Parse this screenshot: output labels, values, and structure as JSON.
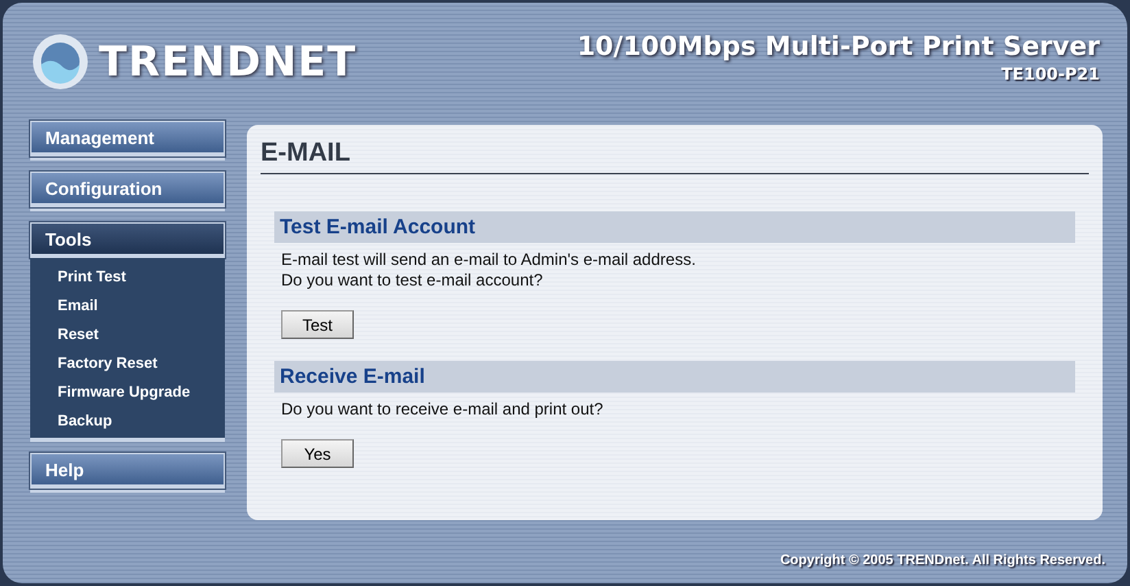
{
  "header": {
    "logo": "TRENDNET",
    "title": "10/100Mbps Multi-Port Print Server",
    "model": "TE100-P21"
  },
  "sidebar": {
    "items": [
      {
        "label": "Management",
        "selected": false
      },
      {
        "label": "Configuration",
        "selected": false
      },
      {
        "label": "Tools",
        "selected": true,
        "children": [
          {
            "label": "Print Test"
          },
          {
            "label": "Email"
          },
          {
            "label": "Reset"
          },
          {
            "label": "Factory Reset"
          },
          {
            "label": "Firmware Upgrade"
          },
          {
            "label": "Backup"
          }
        ]
      },
      {
        "label": "Help",
        "selected": false
      }
    ]
  },
  "content": {
    "title": "E-MAIL",
    "sections": [
      {
        "heading": "Test E-mail Account",
        "lines": [
          "E-mail test will send an e-mail to Admin's e-mail address.",
          "Do you want to test e-mail account?"
        ],
        "button": "Test"
      },
      {
        "heading": "Receive E-mail",
        "lines": [
          "Do you want to receive e-mail and print out?"
        ],
        "button": "Yes"
      }
    ]
  },
  "footer": "Copyright © 2005 TRENDnet. All Rights Reserved."
}
